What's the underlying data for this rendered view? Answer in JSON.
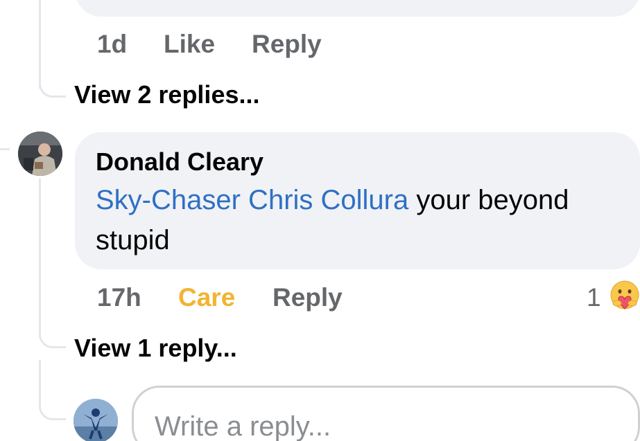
{
  "previous_comment": {
    "time": "1d",
    "like_label": "Like",
    "reply_label": "Reply",
    "view_replies": "View 2 replies..."
  },
  "comment": {
    "author": "Donald Cleary",
    "mention": "Sky-Chaser Chris Collura",
    "text_after_mention": " your beyond stupid",
    "time": "17h",
    "reaction_label": "Care",
    "reaction_color": "#f2b431",
    "reply_label": "Reply",
    "reaction_count": "1",
    "reaction_icon": "care-emoji-icon",
    "view_replies": "View 1 reply..."
  },
  "reply_composer": {
    "placeholder": "Write a reply..."
  },
  "colors": {
    "bubble": "#f0f2f5",
    "mention_link": "#2f6fc4",
    "meta_text": "#65676b"
  }
}
